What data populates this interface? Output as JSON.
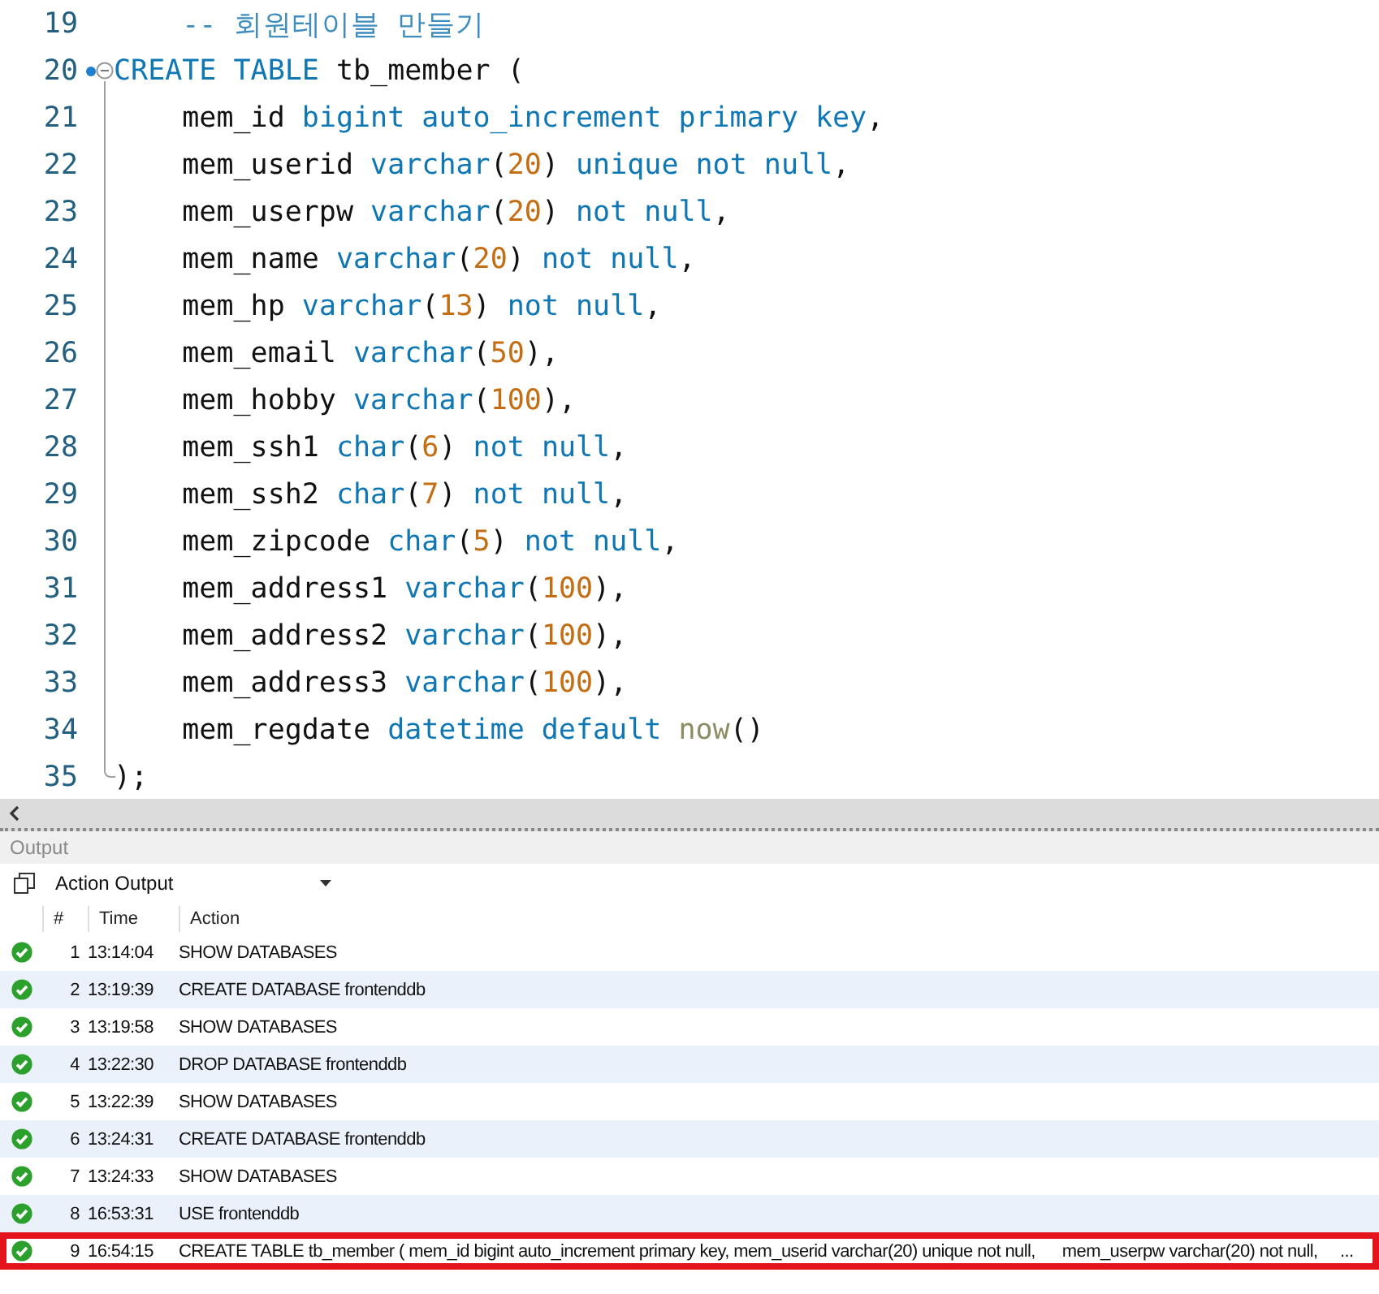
{
  "editor": {
    "lines": [
      {
        "number": "19",
        "marked": false,
        "tokens": [
          {
            "kind": "comment",
            "text": "    -- 회원테이블 만들기"
          }
        ]
      },
      {
        "number": "20",
        "marked": true,
        "tokens": [
          {
            "kind": "keyword",
            "text": "CREATE TABLE"
          },
          {
            "kind": "ident",
            "text": " tb_member ("
          }
        ],
        "children": [
          {
            "number": "21",
            "marked": false,
            "tokens": [
              {
                "kind": "ident",
                "text": "    mem_id "
              },
              {
                "kind": "keyword",
                "text": "bigint auto_increment primary key"
              },
              {
                "kind": "punct",
                "text": ","
              }
            ]
          },
          {
            "number": "22",
            "marked": false,
            "tokens": [
              {
                "kind": "ident",
                "text": "    mem_userid "
              },
              {
                "kind": "keyword",
                "text": "varchar"
              },
              {
                "kind": "punct",
                "text": "("
              },
              {
                "kind": "number",
                "text": "20"
              },
              {
                "kind": "punct",
                "text": ") "
              },
              {
                "kind": "keyword",
                "text": "unique not null"
              },
              {
                "kind": "punct",
                "text": ","
              }
            ]
          },
          {
            "number": "23",
            "marked": false,
            "tokens": [
              {
                "kind": "ident",
                "text": "    mem_userpw "
              },
              {
                "kind": "keyword",
                "text": "varchar"
              },
              {
                "kind": "punct",
                "text": "("
              },
              {
                "kind": "number",
                "text": "20"
              },
              {
                "kind": "punct",
                "text": ") "
              },
              {
                "kind": "keyword",
                "text": "not null"
              },
              {
                "kind": "punct",
                "text": ","
              }
            ]
          },
          {
            "number": "24",
            "marked": false,
            "tokens": [
              {
                "kind": "ident",
                "text": "    mem_name "
              },
              {
                "kind": "keyword",
                "text": "varchar"
              },
              {
                "kind": "punct",
                "text": "("
              },
              {
                "kind": "number",
                "text": "20"
              },
              {
                "kind": "punct",
                "text": ") "
              },
              {
                "kind": "keyword",
                "text": "not null"
              },
              {
                "kind": "punct",
                "text": ","
              }
            ]
          },
          {
            "number": "25",
            "marked": false,
            "tokens": [
              {
                "kind": "ident",
                "text": "    mem_hp "
              },
              {
                "kind": "keyword",
                "text": "varchar"
              },
              {
                "kind": "punct",
                "text": "("
              },
              {
                "kind": "number",
                "text": "13"
              },
              {
                "kind": "punct",
                "text": ") "
              },
              {
                "kind": "keyword",
                "text": "not null"
              },
              {
                "kind": "punct",
                "text": ","
              }
            ]
          },
          {
            "number": "26",
            "marked": false,
            "tokens": [
              {
                "kind": "ident",
                "text": "    mem_email "
              },
              {
                "kind": "keyword",
                "text": "varchar"
              },
              {
                "kind": "punct",
                "text": "("
              },
              {
                "kind": "number",
                "text": "50"
              },
              {
                "kind": "punct",
                "text": "),"
              }
            ]
          },
          {
            "number": "27",
            "marked": false,
            "tokens": [
              {
                "kind": "ident",
                "text": "    mem_hobby "
              },
              {
                "kind": "keyword",
                "text": "varchar"
              },
              {
                "kind": "punct",
                "text": "("
              },
              {
                "kind": "number",
                "text": "100"
              },
              {
                "kind": "punct",
                "text": "),"
              }
            ]
          },
          {
            "number": "28",
            "marked": false,
            "tokens": [
              {
                "kind": "ident",
                "text": "    mem_ssh1 "
              },
              {
                "kind": "keyword",
                "text": "char"
              },
              {
                "kind": "punct",
                "text": "("
              },
              {
                "kind": "number",
                "text": "6"
              },
              {
                "kind": "punct",
                "text": ") "
              },
              {
                "kind": "keyword",
                "text": "not null"
              },
              {
                "kind": "punct",
                "text": ","
              }
            ]
          },
          {
            "number": "29",
            "marked": false,
            "tokens": [
              {
                "kind": "ident",
                "text": "    mem_ssh2 "
              },
              {
                "kind": "keyword",
                "text": "char"
              },
              {
                "kind": "punct",
                "text": "("
              },
              {
                "kind": "number",
                "text": "7"
              },
              {
                "kind": "punct",
                "text": ") "
              },
              {
                "kind": "keyword",
                "text": "not null"
              },
              {
                "kind": "punct",
                "text": ","
              }
            ]
          },
          {
            "number": "30",
            "marked": false,
            "tokens": [
              {
                "kind": "ident",
                "text": "    mem_zipcode "
              },
              {
                "kind": "keyword",
                "text": "char"
              },
              {
                "kind": "punct",
                "text": "("
              },
              {
                "kind": "number",
                "text": "5"
              },
              {
                "kind": "punct",
                "text": ") "
              },
              {
                "kind": "keyword",
                "text": "not null"
              },
              {
                "kind": "punct",
                "text": ","
              }
            ]
          },
          {
            "number": "31",
            "marked": false,
            "tokens": [
              {
                "kind": "ident",
                "text": "    mem_address1 "
              },
              {
                "kind": "keyword",
                "text": "varchar"
              },
              {
                "kind": "punct",
                "text": "("
              },
              {
                "kind": "number",
                "text": "100"
              },
              {
                "kind": "punct",
                "text": "),"
              }
            ]
          },
          {
            "number": "32",
            "marked": false,
            "tokens": [
              {
                "kind": "ident",
                "text": "    mem_address2 "
              },
              {
                "kind": "keyword",
                "text": "varchar"
              },
              {
                "kind": "punct",
                "text": "("
              },
              {
                "kind": "number",
                "text": "100"
              },
              {
                "kind": "punct",
                "text": "),"
              }
            ]
          },
          {
            "number": "33",
            "marked": false,
            "tokens": [
              {
                "kind": "ident",
                "text": "    mem_address3 "
              },
              {
                "kind": "keyword",
                "text": "varchar"
              },
              {
                "kind": "punct",
                "text": "("
              },
              {
                "kind": "number",
                "text": "100"
              },
              {
                "kind": "punct",
                "text": "),"
              }
            ]
          },
          {
            "number": "34",
            "marked": false,
            "tokens": [
              {
                "kind": "ident",
                "text": "    mem_regdate "
              },
              {
                "kind": "keyword",
                "text": "datetime default "
              },
              {
                "kind": "function",
                "text": "now"
              },
              {
                "kind": "punct",
                "text": "()"
              }
            ]
          }
        ],
        "closing": {
          "number": "35",
          "marked": false,
          "tokens": [
            {
              "kind": "punct",
              "text": ");"
            }
          ]
        }
      }
    ]
  },
  "output": {
    "title": "Output",
    "selector": "Action Output",
    "columns": [
      "#",
      "Time",
      "Action"
    ],
    "rows": [
      {
        "number": "1",
        "time": "13:14:04",
        "action": "SHOW DATABASES",
        "highlighted": false
      },
      {
        "number": "2",
        "time": "13:19:39",
        "action": "CREATE DATABASE frontenddb",
        "highlighted": false
      },
      {
        "number": "3",
        "time": "13:19:58",
        "action": "SHOW DATABASES",
        "highlighted": false
      },
      {
        "number": "4",
        "time": "13:22:30",
        "action": "DROP DATABASE frontenddb",
        "highlighted": false
      },
      {
        "number": "5",
        "time": "13:22:39",
        "action": "SHOW DATABASES",
        "highlighted": false
      },
      {
        "number": "6",
        "time": "13:24:31",
        "action": "CREATE DATABASE frontenddb",
        "highlighted": false
      },
      {
        "number": "7",
        "time": "13:24:33",
        "action": "SHOW DATABASES",
        "highlighted": false
      },
      {
        "number": "8",
        "time": "16:53:31",
        "action": "USE frontenddb",
        "highlighted": false
      },
      {
        "number": "9",
        "time": "16:54:15",
        "action": "CREATE TABLE tb_member ( mem_id bigint auto_increment primary key, mem_userid varchar(20) unique not null,      mem_userpw varchar(20) not null,     ...",
        "highlighted": true
      }
    ]
  }
}
